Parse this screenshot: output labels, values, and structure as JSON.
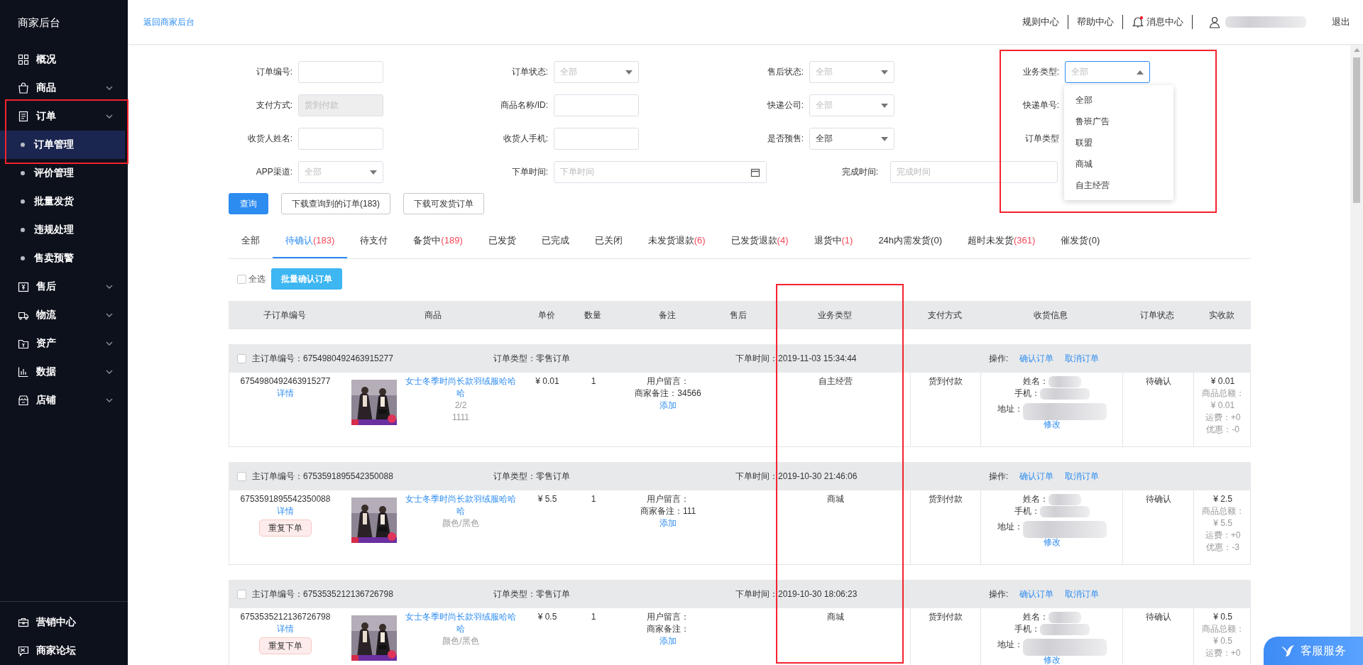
{
  "sidebar": {
    "title": "商家后台",
    "items": [
      {
        "label": "概况",
        "expandable": false
      },
      {
        "label": "商品",
        "expandable": true
      },
      {
        "label": "订单",
        "expandable": true,
        "children": [
          {
            "label": "订单管理",
            "selected": true
          },
          {
            "label": "评价管理",
            "selected": false
          },
          {
            "label": "批量发货",
            "selected": false
          },
          {
            "label": "违规处理",
            "selected": false
          },
          {
            "label": "售卖预警",
            "selected": false
          }
        ]
      },
      {
        "label": "售后",
        "expandable": true
      },
      {
        "label": "物流",
        "expandable": true
      },
      {
        "label": "资产",
        "expandable": true
      },
      {
        "label": "数据",
        "expandable": true
      },
      {
        "label": "店铺",
        "expandable": true
      }
    ],
    "footer_items": [
      {
        "label": "营销中心"
      },
      {
        "label": "商家论坛"
      }
    ]
  },
  "header": {
    "back_link": "返回商家后台",
    "links": [
      "规则中心",
      "帮助中心"
    ],
    "messages": {
      "label": "消息中心",
      "unread": true
    },
    "user": {
      "redacted": true
    },
    "logout": "退出"
  },
  "filters": [
    [
      {
        "label": "订单编号:",
        "kind": "text"
      },
      {
        "label": "订单状态:",
        "kind": "select",
        "placeholder": "全部"
      },
      {
        "label": "售后状态:",
        "kind": "select",
        "placeholder": "全部"
      },
      {
        "label": "业务类型:",
        "kind": "select",
        "placeholder": "全部",
        "focused": true,
        "open": true,
        "options": [
          {
            "label": "全部",
            "selected": false
          },
          {
            "label": "鲁班广告",
            "selected": false
          },
          {
            "label": "联盟",
            "selected": false
          },
          {
            "label": "商城",
            "selected": false
          },
          {
            "label": "自主经营",
            "selected": false
          }
        ]
      }
    ],
    [
      {
        "label": "支付方式:",
        "kind": "disabled",
        "value": "货到付款"
      },
      {
        "label": "商品名称/ID:",
        "kind": "text"
      },
      {
        "label": "快递公司:",
        "kind": "select",
        "placeholder": "全部"
      },
      {
        "label": "快递单号:",
        "kind": "covered"
      }
    ],
    [
      {
        "label": "收货人姓名:",
        "kind": "text"
      },
      {
        "label": "收货人手机:",
        "kind": "text"
      },
      {
        "label": "是否预售:",
        "kind": "select",
        "value": "全部"
      },
      {
        "label": "订单类型",
        "kind": "covered"
      }
    ],
    [
      {
        "label": "APP渠道:",
        "kind": "select",
        "placeholder": "全部"
      },
      {
        "label": "下单时间:",
        "kind": "date",
        "placeholder": "下单时间"
      },
      {
        "label": "完成时间:",
        "kind": "text",
        "placeholder": "完成时间"
      }
    ]
  ],
  "actions": [
    {
      "label": "查询",
      "kind": "primary"
    },
    {
      "label": "下载查询到的订单(183)",
      "kind": "default"
    },
    {
      "label": "下载可发货订单",
      "kind": "default"
    }
  ],
  "tabs": [
    {
      "label": "全部",
      "selected": false
    },
    {
      "label": "待确认",
      "count": "(183)",
      "alert": true,
      "selected": true
    },
    {
      "label": "待支付",
      "selected": false
    },
    {
      "label": "备货中",
      "count": "(189)",
      "alert": true,
      "selected": false
    },
    {
      "label": "已发货",
      "selected": false
    },
    {
      "label": "已完成",
      "selected": false
    },
    {
      "label": "已关闭",
      "selected": false
    },
    {
      "label": "未发货退款",
      "count": "(6)",
      "alert": true,
      "selected": false
    },
    {
      "label": "已发货退款",
      "count": "(4)",
      "alert": true,
      "selected": false
    },
    {
      "label": "退货中",
      "count": "(1)",
      "alert": true,
      "selected": false
    },
    {
      "label": "24h内需发货",
      "count": "(0)",
      "alert": false,
      "selected": false
    },
    {
      "label": "超时未发货",
      "count": "(361)",
      "alert": true,
      "selected": false
    },
    {
      "label": "催发货",
      "count": "(0)",
      "alert": false,
      "selected": false
    }
  ],
  "batch": {
    "select_all": {
      "label": "全选",
      "checked": false
    },
    "button": "批量确认订单"
  },
  "columns": [
    "子订单编号",
    "商品",
    "单价",
    "数量",
    "备注",
    "售后",
    "业务类型",
    "支付方式",
    "收货信息",
    "订单状态",
    "实收款"
  ],
  "orders": [
    {
      "checked": false,
      "id": "主订单编号：6754980492463915277",
      "type": "订单类型：零售订单",
      "time_label": "下单时间：",
      "time": "2019-11-03 15:34:44",
      "ops_label": "操作:",
      "ops": [
        "确认订单",
        "取消订单"
      ],
      "sub_id": "6754980492463915277",
      "detail": "详情",
      "title": "女士冬季时尚长款羽绒服哈哈哈",
      "specs": [
        "2/2",
        "1111"
      ],
      "price": "¥ 0.01",
      "qty": "1",
      "remarks": [
        "用户留言：",
        "商家备注：34566"
      ],
      "add": "添加",
      "business": "自主经营",
      "payment": "货到付款",
      "receiver": {
        "lines": [
          "姓名：",
          "手机：",
          "地址："
        ],
        "redacted": true,
        "edit": "修改"
      },
      "status": "待确认",
      "total": "¥ 0.01",
      "amounts": [
        "商品总额：",
        "¥ 0.01",
        "运费：+0",
        "优惠：-0"
      ]
    },
    {
      "checked": false,
      "id": "主订单编号：6753591895542350088",
      "type": "订单类型：零售订单",
      "time_label": "下单时间：",
      "time": "2019-10-30 21:46:06",
      "ops_label": "操作:",
      "ops": [
        "确认订单",
        "取消订单"
      ],
      "sub_id": "6753591895542350088",
      "detail": "详情",
      "reorder": "重复下单",
      "title": "女士冬季时尚长款羽绒服哈哈哈",
      "specs": [
        "颜色/黑色"
      ],
      "price": "¥ 5.5",
      "qty": "1",
      "remarks": [
        "用户留言：",
        "商家备注：111"
      ],
      "add": "添加",
      "business": "商城",
      "payment": "货到付款",
      "receiver": {
        "lines": [
          "姓名：",
          "手机：",
          "地址："
        ],
        "redacted": true,
        "edit": "修改"
      },
      "status": "待确认",
      "total": "¥ 2.5",
      "amounts": [
        "商品总额：",
        "¥ 5.5",
        "运费：+0",
        "优惠：-3"
      ]
    },
    {
      "checked": false,
      "id": "主订单编号：6753535212136726798",
      "type": "订单类型：零售订单",
      "time_label": "下单时间：",
      "time": "2019-10-30 18:06:23",
      "ops_label": "操作:",
      "ops": [
        "确认订单",
        "取消订单"
      ],
      "sub_id": "6753535212136726798",
      "detail": "详情",
      "reorder": "重复下单",
      "title": "女士冬季时尚长款羽绒服哈哈哈",
      "specs": [
        "颜色/黑色"
      ],
      "price": "¥ 0.5",
      "qty": "1",
      "remarks": [
        "用户留言：",
        "商家备注："
      ],
      "add": "添加",
      "business": "商城",
      "payment": "货到付款",
      "receiver": {
        "lines": [
          "姓名：",
          "手机：",
          "地址："
        ],
        "redacted": true,
        "edit": "修改"
      },
      "status": "待确认",
      "total": "¥ 0.5",
      "amounts": [
        "商品总额：",
        "¥ 0.5",
        "运费：+0"
      ]
    }
  ],
  "service_button": "客服服务",
  "annotations": [
    {
      "kind": "frame"
    },
    {
      "kind": "frame"
    },
    {
      "kind": "frame"
    }
  ]
}
